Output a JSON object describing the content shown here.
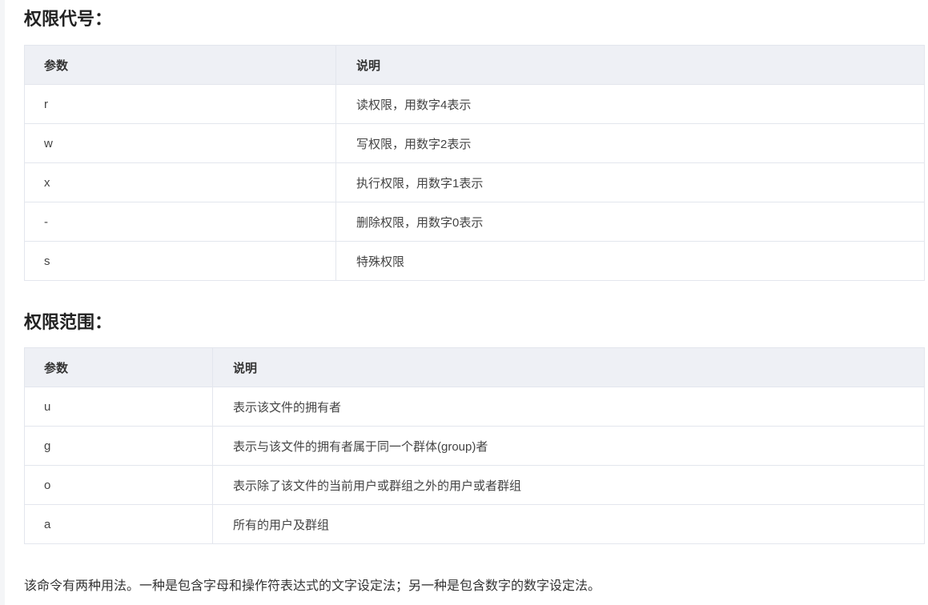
{
  "section1": {
    "heading": "权限代号：",
    "headers": [
      "参数",
      "说明"
    ],
    "rows": [
      [
        "r",
        "读权限，用数字4表示"
      ],
      [
        "w",
        "写权限，用数字2表示"
      ],
      [
        "x",
        "执行权限，用数字1表示"
      ],
      [
        "-",
        "删除权限，用数字0表示"
      ],
      [
        "s",
        "特殊权限"
      ]
    ]
  },
  "section2": {
    "heading": "权限范围：",
    "headers": [
      "参数",
      "说明"
    ],
    "rows": [
      [
        "u",
        "表示该文件的拥有者"
      ],
      [
        "g",
        "表示与该文件的拥有者属于同一个群体(group)者"
      ],
      [
        "o",
        "表示除了该文件的当前用户或群组之外的用户或者群组"
      ],
      [
        "a",
        "所有的用户及群组"
      ]
    ]
  },
  "paragraph": "该命令有两种用法。一种是包含字母和操作符表达式的文字设定法；另一种是包含数字的数字设定法。"
}
